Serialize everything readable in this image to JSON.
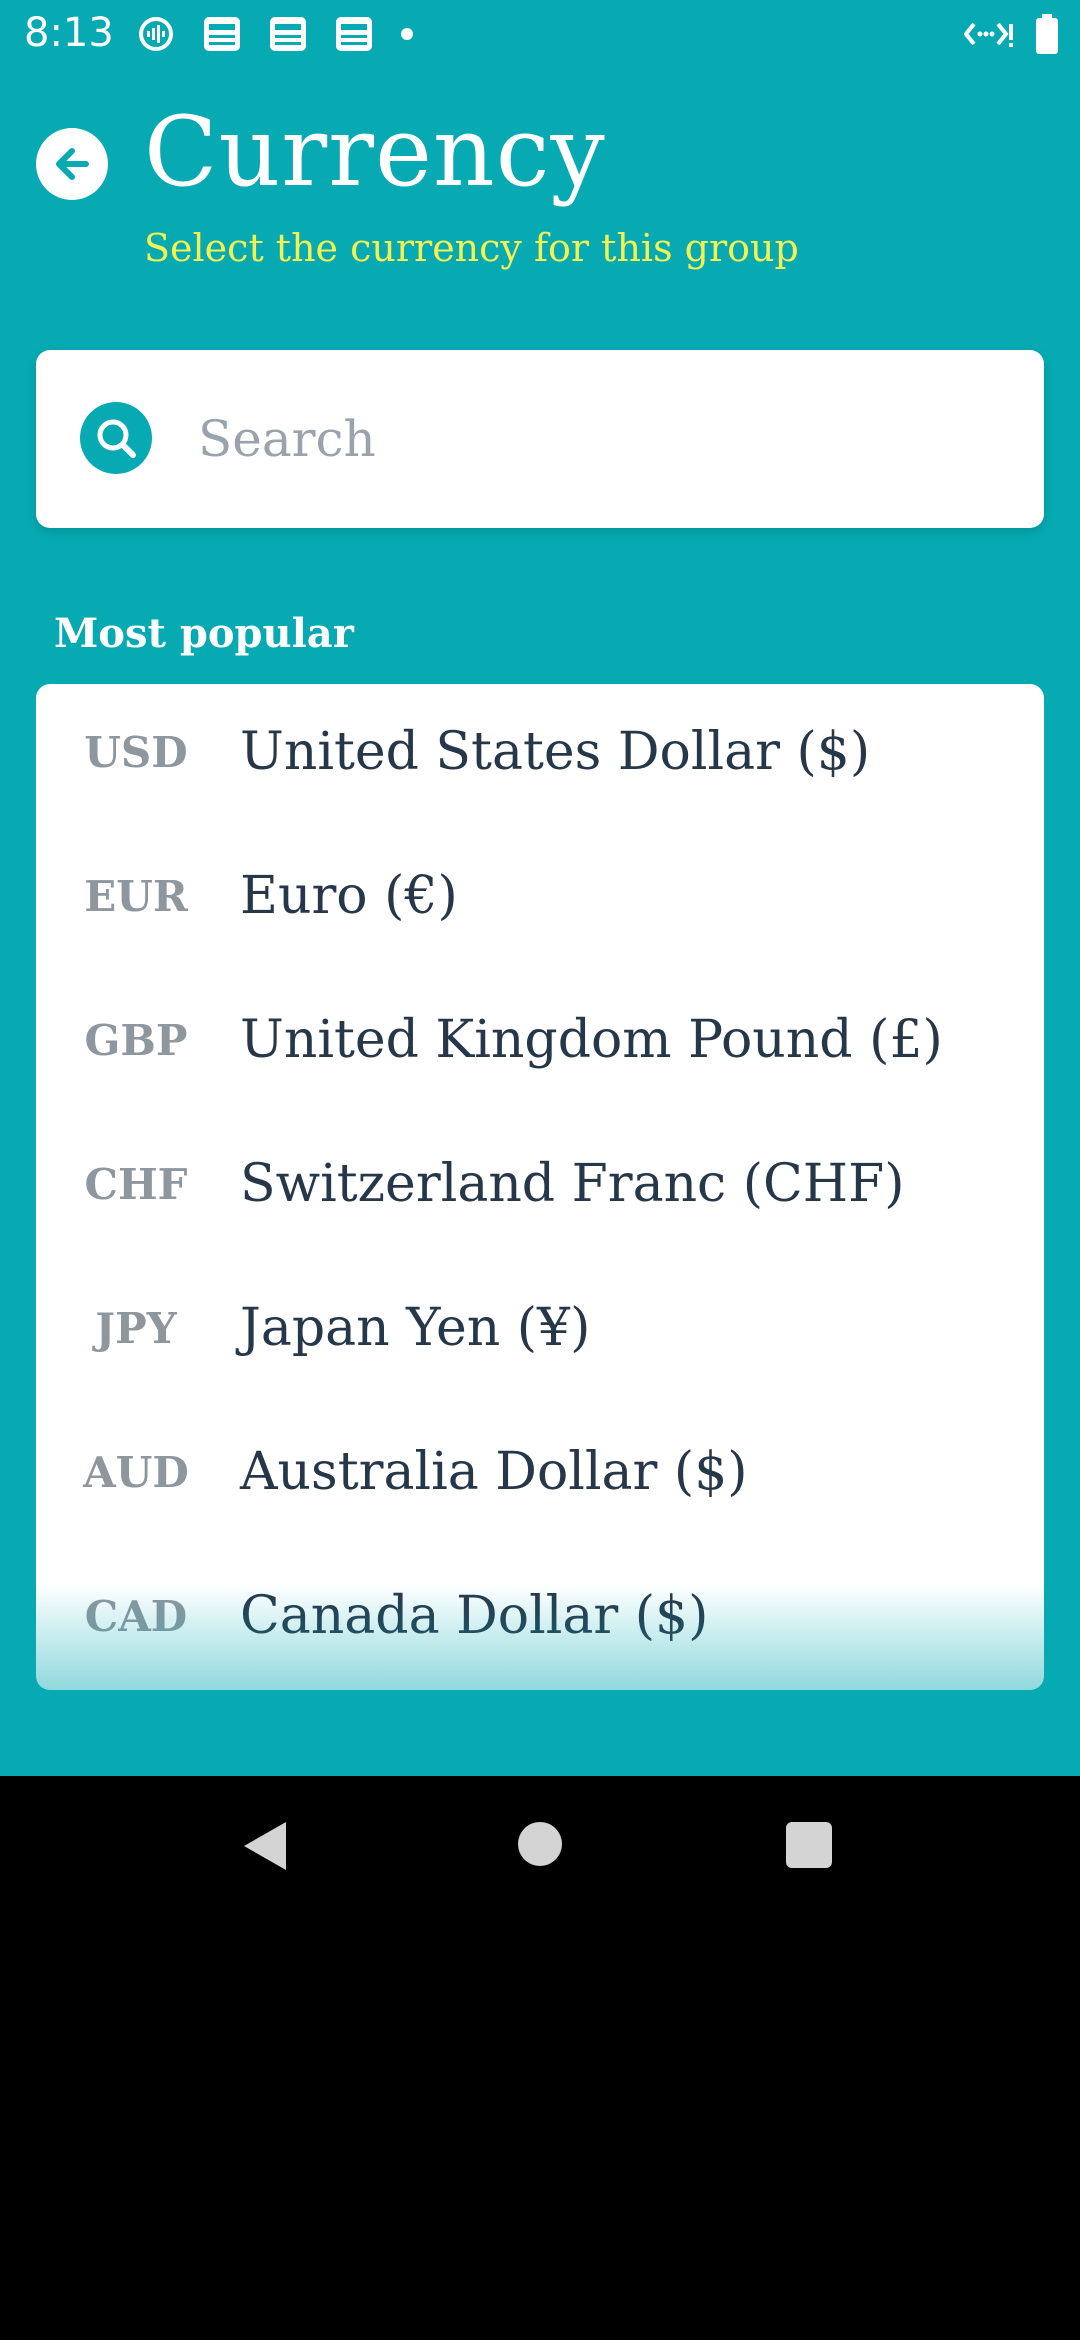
{
  "status_bar": {
    "time": "8:13",
    "notification_icons": [
      "podcast-icon",
      "news-icon",
      "news-icon",
      "news-icon",
      "dot-icon"
    ],
    "right_icons": [
      "data-saver-icon",
      "battery-icon"
    ]
  },
  "header": {
    "back_icon": "arrow-left-icon",
    "title": "Currency",
    "subtitle": "Select the currency for this group"
  },
  "search": {
    "icon": "search-icon",
    "placeholder": "Search",
    "value": ""
  },
  "popular": {
    "label": "Most popular",
    "items": [
      {
        "code": "USD",
        "name": "United States Dollar ($)"
      },
      {
        "code": "EUR",
        "name": "Euro (€)"
      },
      {
        "code": "GBP",
        "name": "United Kingdom Pound (£)"
      },
      {
        "code": "CHF",
        "name": "Switzerland Franc (CHF)"
      },
      {
        "code": "JPY",
        "name": "Japan Yen (¥)"
      },
      {
        "code": "AUD",
        "name": "Australia Dollar ($)"
      },
      {
        "code": "CAD",
        "name": "Canada Dollar ($)"
      }
    ]
  },
  "colors": {
    "background": "#07aab3",
    "subtitle": "#f2f250",
    "code_text": "#8e969e",
    "name_text": "#26374a"
  },
  "nav": {
    "back_icon": "nav-back-icon",
    "home_icon": "nav-home-icon",
    "recents_icon": "nav-recents-icon"
  }
}
